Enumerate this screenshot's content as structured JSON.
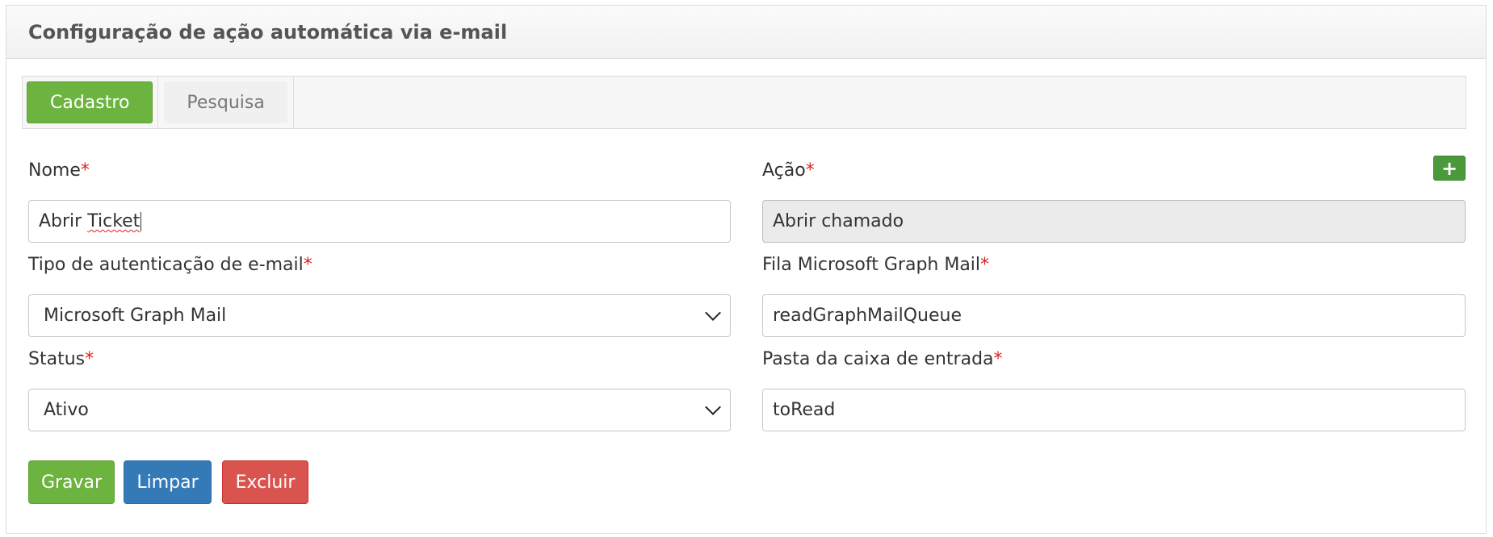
{
  "panel": {
    "title": "Configuração de ação automática via e-mail"
  },
  "tabs": [
    {
      "label": "Cadastro",
      "active": true
    },
    {
      "label": "Pesquisa",
      "active": false
    }
  ],
  "form": {
    "nome": {
      "label": "Nome",
      "required_mark": "*",
      "value_plain": "Abrir ",
      "value_flagged": "Ticket"
    },
    "acao": {
      "label": "Ação",
      "required_mark": "*",
      "value": "Abrir chamado",
      "add_label": "+"
    },
    "tipo_autenticacao": {
      "label": "Tipo de autenticação de e-mail",
      "required_mark": "*",
      "value": "Microsoft Graph Mail"
    },
    "fila": {
      "label": "Fila Microsoft Graph Mail",
      "required_mark": "*",
      "value": "readGraphMailQueue"
    },
    "status": {
      "label": "Status",
      "required_mark": "*",
      "value": "Ativo"
    },
    "pasta": {
      "label": "Pasta da caixa de entrada",
      "required_mark": "*",
      "value": "toRead"
    }
  },
  "buttons": {
    "save": "Gravar",
    "clear": "Limpar",
    "delete": "Excluir"
  },
  "colors": {
    "success": "#6db33f",
    "primary": "#337ab7",
    "danger": "#d9534f",
    "required": "#e02020"
  }
}
